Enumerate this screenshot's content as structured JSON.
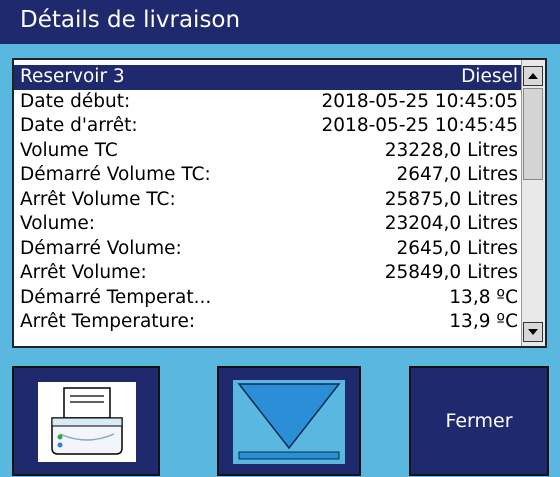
{
  "window": {
    "title": "Détails de livraison"
  },
  "details": {
    "rows": [
      {
        "label": "Reservoir 3",
        "value": "Diesel"
      },
      {
        "label": "Date début:",
        "value": "2018-05-25 10:45:05"
      },
      {
        "label": "Date d'arrêt:",
        "value": "2018-05-25 10:45:45"
      },
      {
        "label": "Volume TC",
        "value": "23228,0 Litres"
      },
      {
        "label": "Démarré Volume TC:",
        "value": "2647,0 Litres"
      },
      {
        "label": "Arrêt Volume TC:",
        "value": "25875,0 Litres"
      },
      {
        "label": "Volume:",
        "value": "23204,0 Litres"
      },
      {
        "label": "Démarré Volume:",
        "value": "2645,0 Litres"
      },
      {
        "label": "Arrêt Volume:",
        "value": "25849,0 Litres"
      },
      {
        "label": "Démarré Temperat...",
        "value": "13,8 ºC"
      },
      {
        "label": "Arrêt Temperature:",
        "value": "13,9 ºC"
      }
    ]
  },
  "buttons": {
    "print_icon": "printer-icon",
    "down_icon": "scroll-down-arrow-icon",
    "close_label": "Fermer"
  },
  "colors": {
    "background": "#5ab8e0",
    "navy": "#1f2a6e",
    "accent": "#3aa3e0"
  }
}
